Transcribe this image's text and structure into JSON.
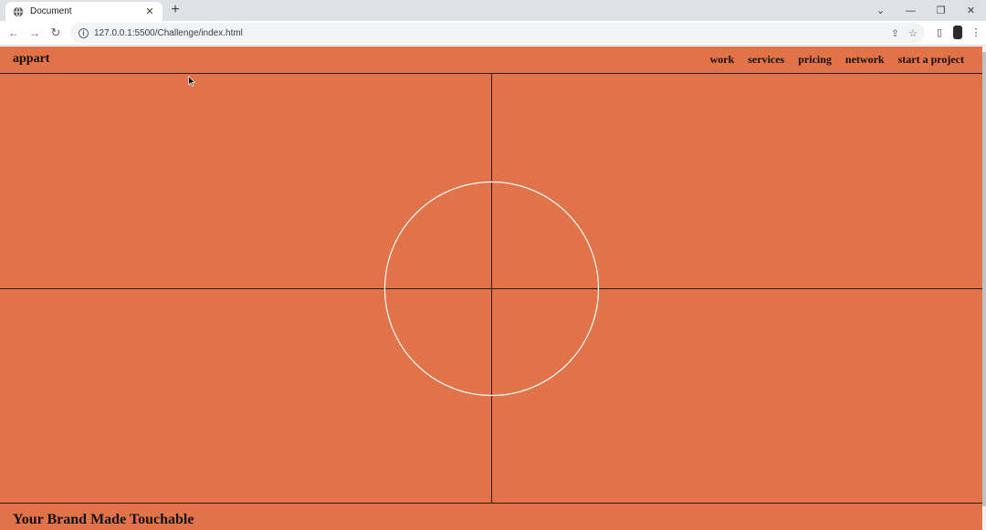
{
  "browser": {
    "tab_title": "Document",
    "tab_close": "✕",
    "new_tab": "+",
    "url": "127.0.0.1:5500/Challenge/index.html",
    "window_controls": {
      "tabs_menu": "⌄",
      "minimize": "—",
      "restore": "❐",
      "close": "✕"
    },
    "nav_back": "←",
    "nav_forward": "→",
    "nav_reload": "↻",
    "omni_share": "⇪",
    "omni_star": "☆",
    "side_panel": "▯",
    "menu": "⋮"
  },
  "site": {
    "logo": "appart",
    "nav": [
      "work",
      "services",
      "pricing",
      "network",
      "start a project"
    ],
    "hero_title": "Your Brand Made Touchable"
  },
  "colors": {
    "page_bg": "#e37449",
    "lines": "#2a1a12",
    "circle": "#ffffff"
  }
}
